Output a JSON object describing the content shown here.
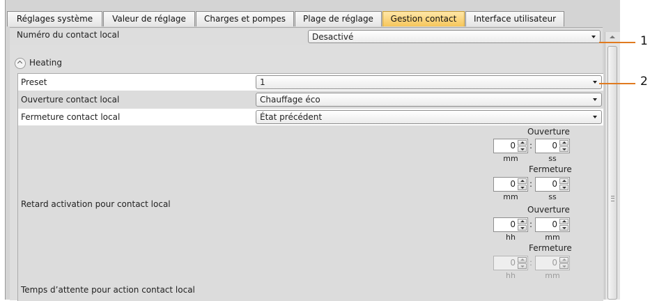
{
  "tabs": [
    {
      "label": "Réglages système"
    },
    {
      "label": "Valeur de réglage"
    },
    {
      "label": "Charges et pompes"
    },
    {
      "label": "Plage de réglage"
    },
    {
      "label": "Gestion contact",
      "active": true
    },
    {
      "label": "Interface utilisateur"
    }
  ],
  "local_contact": {
    "label": "Numéro du contact local",
    "value": "Desactivé"
  },
  "heating": {
    "title": "Heating",
    "preset": {
      "label": "Preset",
      "value": "1"
    },
    "opening": {
      "label": "Ouverture contact local",
      "value": "Chauffage éco"
    },
    "closing": {
      "label": "Fermeture contact local",
      "value": "État précédent"
    },
    "activation_delay": {
      "label": "Retard activation pour contact local",
      "opening": {
        "title": "Ouverture",
        "first": "0",
        "second": "0",
        "unit_first": "mm",
        "unit_second": "ss"
      },
      "closing": {
        "title": "Fermeture",
        "first": "0",
        "second": "0",
        "unit_first": "mm",
        "unit_second": "ss"
      }
    },
    "wait_time": {
      "label": "Temps d’attente pour action contact local",
      "opening": {
        "title": "Ouverture",
        "first": "0",
        "second": "0",
        "unit_first": "hh",
        "unit_second": "mm"
      },
      "closing": {
        "title": "Fermeture",
        "first": "0",
        "second": "0",
        "unit_first": "hh",
        "unit_second": "mm"
      }
    }
  },
  "callouts": [
    "1",
    "2"
  ],
  "colors": {
    "active_tab": "#f6c65b",
    "callout_line": "#e07a1f",
    "panel_background": "#dcdcdc"
  }
}
